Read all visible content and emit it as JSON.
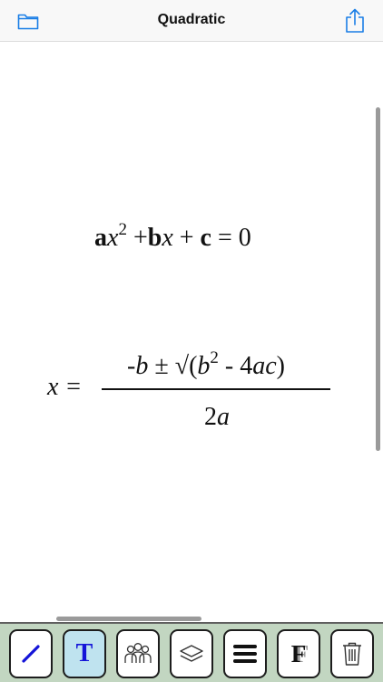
{
  "navbar": {
    "title": "Quadratic",
    "left_icon": "folder-icon",
    "right_icon": "share-icon"
  },
  "equation1": {
    "a": "a",
    "x": "x",
    "exp": "2",
    "plus_b": " +",
    "b": "b",
    "x2": "x",
    "plus_c": " + ",
    "c": "c",
    "equals_zero": " = 0"
  },
  "equation2": {
    "lhs": "x =",
    "num_pre": "-",
    "num_b": "b",
    "num_pm": " ± √(",
    "num_b2": "b",
    "num_exp": "2",
    "num_post1": " - 4",
    "num_ac": "ac",
    "num_close": ")",
    "den_2": "2",
    "den_a": "a"
  },
  "toolbar": {
    "tools": [
      {
        "name": "draw-line",
        "icon": "pen-line-icon"
      },
      {
        "name": "text",
        "label": "T",
        "icon": "text-icon"
      },
      {
        "name": "group",
        "icon": "group-icon"
      },
      {
        "name": "layers",
        "icon": "layers-icon"
      },
      {
        "name": "menu",
        "icon": "menu-icon"
      },
      {
        "name": "font",
        "label": "F",
        "icon": "font-icon"
      },
      {
        "name": "delete",
        "icon": "trash-icon"
      }
    ]
  },
  "colors": {
    "accent": "#1a7ee6",
    "toolbar_bg": "#c2d6c1",
    "text_tool": "#1414d8",
    "selected_tool": "#bfe3ef"
  }
}
